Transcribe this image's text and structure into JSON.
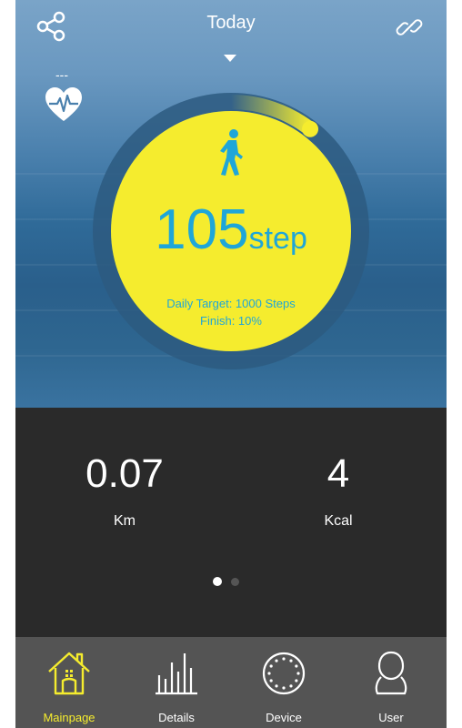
{
  "header": {
    "title": "Today"
  },
  "heart": {
    "value": "---"
  },
  "progress": {
    "steps": "105",
    "unit": "step",
    "target_text": "Daily Target: 1000 Steps",
    "finish_text": "Finish: 10%",
    "fraction": 0.105
  },
  "stats": {
    "distance": {
      "value": "0.07",
      "label": "Km"
    },
    "calories": {
      "value": "4",
      "label": "Kcal"
    }
  },
  "pager": {
    "pages": 2,
    "active": 0
  },
  "nav": [
    {
      "label": "Mainpage",
      "icon": "house-icon",
      "active": true
    },
    {
      "label": "Details",
      "icon": "bar-chart-icon",
      "active": false
    },
    {
      "label": "Device",
      "icon": "watch-icon",
      "active": false
    },
    {
      "label": "User",
      "icon": "user-icon",
      "active": false
    }
  ],
  "colors": {
    "accent": "#f5ec2e",
    "step_text": "#1fa6d8",
    "stats_bg": "#2a2a2a",
    "nav_bg": "#545454"
  }
}
